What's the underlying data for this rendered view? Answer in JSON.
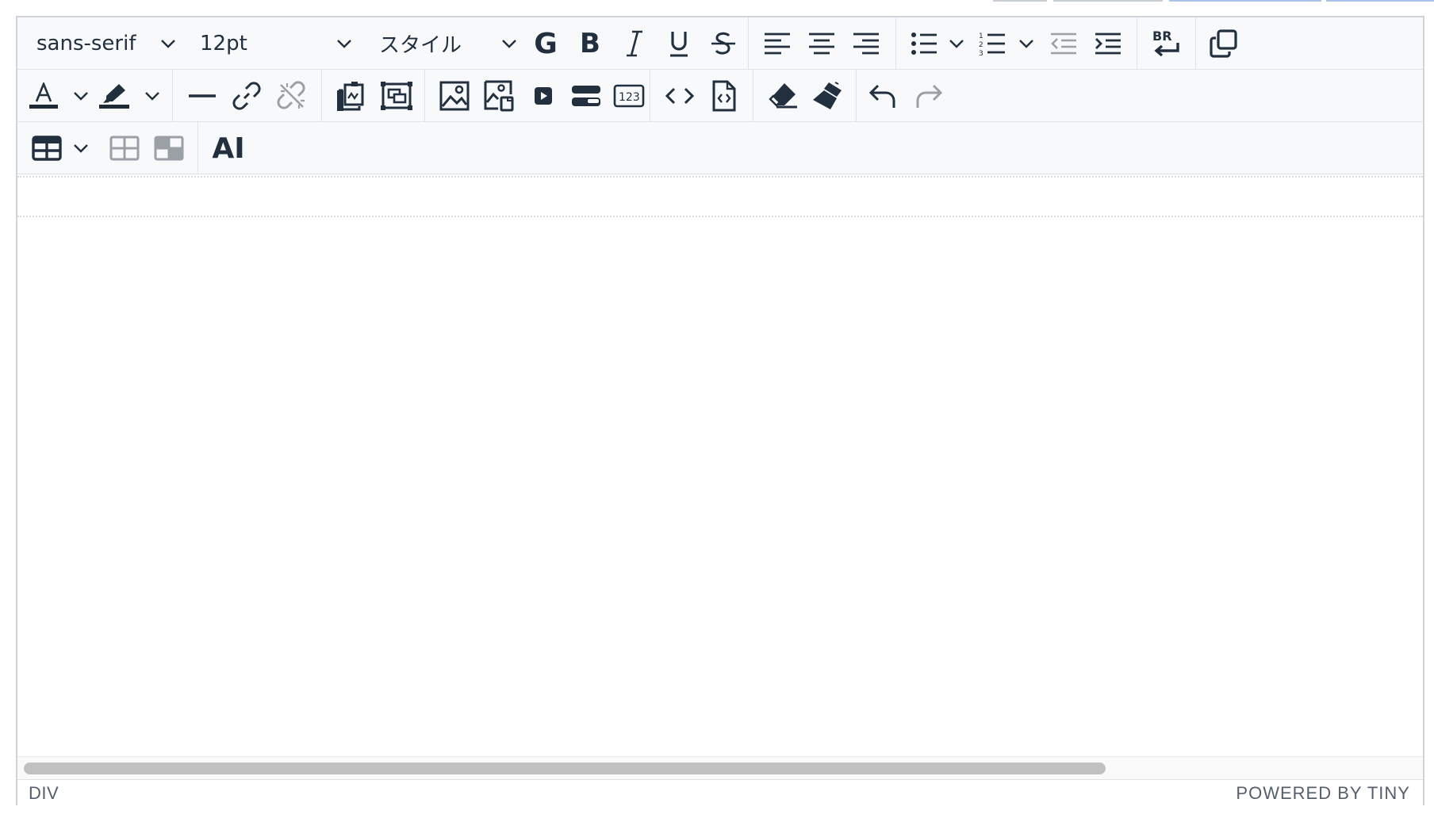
{
  "toolbar": {
    "font_family": {
      "value": "sans-serif"
    },
    "font_size": {
      "value": "12pt"
    },
    "styles": {
      "value": "スタイル"
    },
    "bold_g_label": "G",
    "bold_b_label": "B",
    "ai_label": "AI",
    "br_label": "BR",
    "text_color": "#1f2a37",
    "highlight_color": "#1f2a37"
  },
  "icons": [
    "chevron-down-icon",
    "bold-g-icon",
    "bold-icon",
    "italic-icon",
    "underline-icon",
    "strikethrough-icon",
    "align-left-icon",
    "align-center-icon",
    "align-right-icon",
    "bullet-list-icon",
    "numbered-list-icon",
    "outdent-icon",
    "indent-icon",
    "line-break-icon",
    "copy-icon",
    "text-color-icon",
    "highlight-icon",
    "horizontal-rule-icon",
    "link-icon",
    "unlink-icon",
    "paste-icon",
    "fullscreen-icon",
    "image-icon",
    "image-edit-icon",
    "media-icon",
    "template-icon",
    "character-count-icon",
    "code-icon",
    "source-code-icon",
    "eraser-icon",
    "format-painter-icon",
    "undo-icon",
    "redo-icon",
    "table-icon",
    "table-props-icon",
    "table-cell-icon"
  ],
  "statusbar": {
    "path": "DIV",
    "brand": "POWERED BY TINY"
  }
}
